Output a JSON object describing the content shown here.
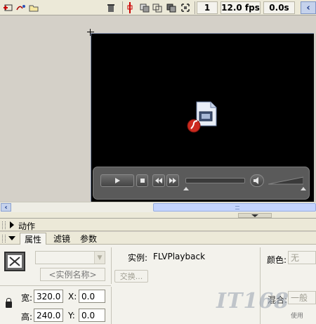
{
  "toolbar": {
    "frame": "1",
    "fps": "12.0 fps",
    "time": "0.0s"
  },
  "panels": {
    "actions_title": "动作"
  },
  "tabs": [
    {
      "label": "属性"
    },
    {
      "label": "滤镜"
    },
    {
      "label": "参数"
    }
  ],
  "properties": {
    "instance_name_placeholder": "<实例名称>",
    "instance_label": "实例:",
    "component_name": "FLVPlayback",
    "swap_button": "交换...",
    "color_label": "颜色:",
    "color_value": "无",
    "width_label": "宽:",
    "width_value": "320.0",
    "height_label": "高:",
    "height_value": "240.0",
    "x_label": "X:",
    "x_value": "0.0",
    "y_label": "Y:",
    "y_value": "0.0",
    "blend_label": "混合:",
    "blend_value": "一般",
    "cache_label": "使用"
  },
  "watermark": {
    "text": "IT168",
    "sub": "使用"
  },
  "colors": {
    "stage": "#000000",
    "workspace": "#d4d0c8",
    "panel": "#f3f2ec",
    "accent_blue": "#c3d3fd"
  }
}
